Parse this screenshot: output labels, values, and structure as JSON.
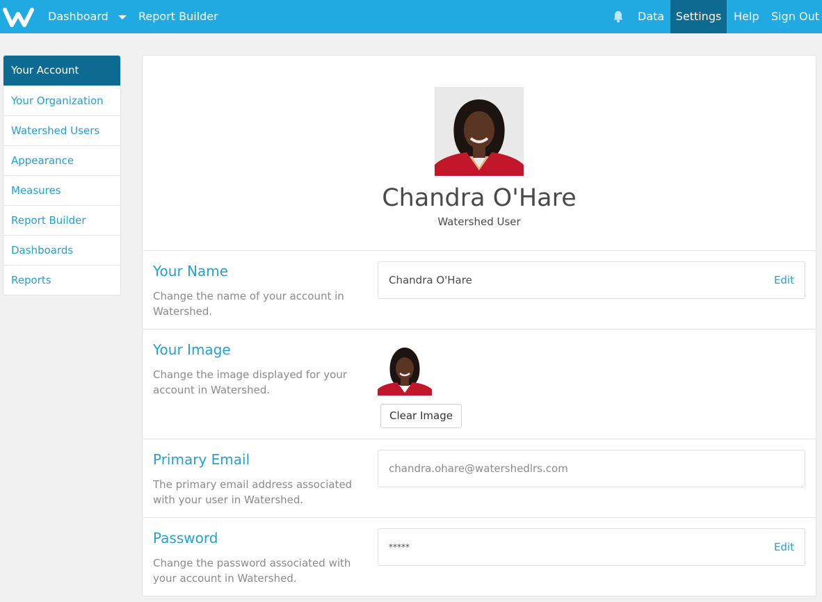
{
  "nav": {
    "dashboard": "Dashboard",
    "report_builder": "Report Builder",
    "data": "Data",
    "settings": "Settings",
    "help": "Help",
    "sign_out": "Sign Out"
  },
  "sidebar": {
    "items": [
      {
        "label": "Your Account",
        "active": true
      },
      {
        "label": "Your Organization"
      },
      {
        "label": "Watershed Users"
      },
      {
        "label": "Appearance"
      },
      {
        "label": "Measures"
      },
      {
        "label": "Report Builder"
      },
      {
        "label": "Dashboards"
      },
      {
        "label": "Reports"
      }
    ]
  },
  "profile": {
    "name": "Chandra O'Hare",
    "role": "Watershed User"
  },
  "sections": {
    "name": {
      "title": "Your Name",
      "description": "Change the name of your account in Watershed.",
      "value": "Chandra O'Hare",
      "edit": "Edit"
    },
    "image": {
      "title": "Your Image",
      "description": "Change the image displayed for your account in Watershed.",
      "clear": "Clear Image"
    },
    "email": {
      "title": "Primary Email",
      "description": "The primary email address associated with your user in Watershed.",
      "value": "chandra.ohare@watershedlrs.com"
    },
    "password": {
      "title": "Password",
      "description": "Change the password associated with your account in Watershed.",
      "value": "*****",
      "edit": "Edit"
    }
  },
  "colors": {
    "topbar": "#21aae2",
    "active": "#0d6a91",
    "link": "#21a1d6"
  }
}
